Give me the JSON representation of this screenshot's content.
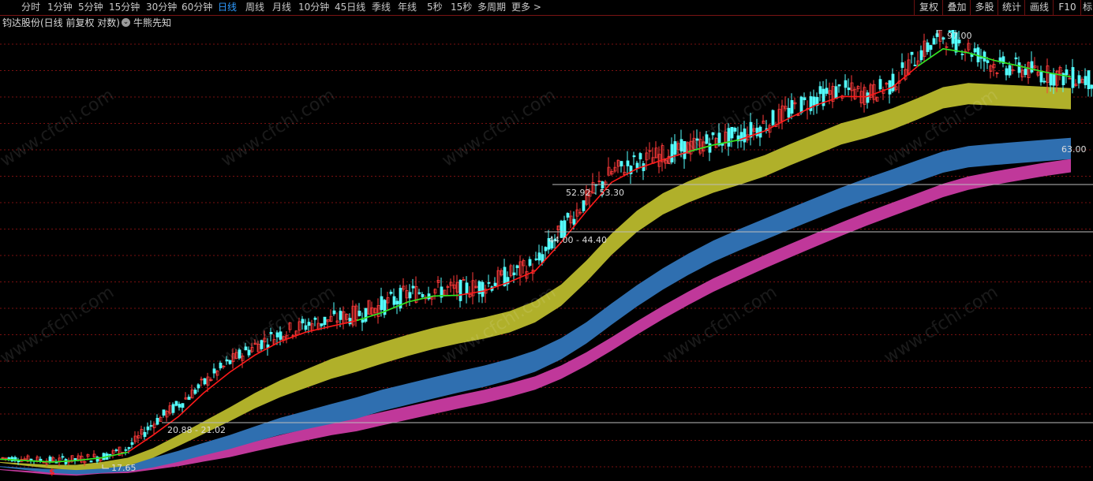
{
  "toolbar": {
    "periods": [
      "分时",
      "1分钟",
      "5分钟",
      "15分钟",
      "30分钟",
      "60分钟",
      "日线",
      "周线",
      "月线",
      "10分钟",
      "45日线",
      "季线",
      "年线",
      "5秒",
      "15秒",
      "多周期",
      "更多 >"
    ],
    "active_period": "日线",
    "right_buttons": [
      "复权",
      "叠加",
      "多股",
      "统计",
      "画线",
      "F10",
      "标"
    ]
  },
  "infobar": {
    "title": "钧达股份(日线 前复权 对数)",
    "indicator": "牛熊先知",
    "indicator_icon": "chevron-down-icon"
  },
  "watermark": "www.cfchi.com",
  "colors": {
    "background": "#000000",
    "grid": "#7a1010",
    "up_candle": "#ff3a3a",
    "down_candle": "#54ffff",
    "ma_red": "#ff1a1a",
    "ma_green": "#22ee22",
    "band_yellow": "#b0b02a",
    "band_blue": "#2f6fb0",
    "band_magenta": "#c0389a",
    "signal": "#ff2020"
  },
  "chart_data": {
    "type": "line",
    "scale": "log",
    "price_labels": {
      "high": "97.00",
      "low": "17.65",
      "levels": [
        "20.88 - 21.02",
        "44.00 - 44.40",
        "52.92 - 53.30",
        "63.00"
      ]
    },
    "series": [
      {
        "values": [
          17.9,
          17.8,
          17.7,
          17.8,
          18.0,
          18.6,
          20.6,
          22.2,
          24.2,
          26.3,
          28.1,
          29.5,
          30.5,
          31.1,
          31.8,
          33.0,
          34.5,
          35.1,
          35.0,
          35.7,
          37.3,
          38.8,
          44.5,
          50.5,
          56.3,
          58.5,
          60.2,
          62.0,
          63.7,
          65.0,
          68.0,
          72.0,
          75.8,
          78.0,
          76.5,
          80.0,
          90.0,
          97.0,
          92.0,
          86.0,
          85.0,
          83.0,
          82.0
        ]
      },
      {
        "values": [
          17.8,
          17.7,
          17.6,
          17.7,
          17.9,
          18.3,
          19.6,
          21.1,
          23.2,
          25.2,
          27.0,
          28.5,
          29.6,
          30.3,
          31.0,
          32.0,
          33.4,
          34.2,
          34.3,
          34.9,
          36.2,
          37.8,
          42.4,
          48.0,
          53.9,
          56.9,
          59.0,
          60.9,
          62.6,
          63.9,
          66.2,
          69.8,
          73.4,
          76.0,
          75.9,
          78.9,
          85.8,
          92.0,
          90.5,
          87.8,
          85.8,
          83.8,
          82.2
        ]
      },
      {
        "values": [
          17.6,
          17.5,
          17.4,
          17.4,
          17.6,
          17.9,
          18.6,
          19.6,
          20.7,
          21.9,
          23.2,
          24.4,
          25.5,
          26.6,
          27.5,
          28.4,
          29.3,
          30.1,
          30.8,
          31.4,
          32.2,
          33.5,
          35.8,
          39.4,
          43.9,
          48.1,
          51.6,
          54.1,
          56.3,
          58.1,
          60.1,
          62.8,
          65.5,
          68.3,
          70.1,
          72.5,
          75.5,
          78.9,
          80.2,
          79.8,
          79.4,
          79.0,
          78.6
        ]
      },
      {
        "values": [
          17.3,
          17.2,
          17.1,
          17.1,
          17.3,
          17.5,
          17.9,
          18.4,
          19.0,
          19.6,
          20.3,
          21.0,
          21.6,
          22.2,
          22.8,
          23.5,
          24.1,
          24.7,
          25.3,
          25.9,
          26.6,
          27.5,
          28.9,
          30.8,
          33.2,
          35.7,
          38.2,
          40.5,
          42.7,
          44.7,
          46.6,
          48.6,
          50.7,
          52.8,
          54.8,
          56.8,
          58.9,
          61.0,
          62.3,
          62.9,
          63.4,
          63.9,
          64.4
        ]
      },
      {
        "values": [
          17.1,
          17.0,
          16.9,
          16.9,
          17.1,
          17.2,
          17.5,
          17.8,
          18.2,
          18.6,
          19.1,
          19.6,
          20.1,
          20.6,
          21.0,
          21.5,
          22.0,
          22.5,
          23.0,
          23.5,
          24.1,
          24.8,
          25.9,
          27.3,
          29.0,
          30.9,
          32.9,
          34.8,
          36.7,
          38.5,
          40.3,
          42.1,
          44.0,
          45.9,
          47.8,
          49.7,
          51.6,
          53.6,
          55.2,
          56.3,
          57.3,
          58.3,
          59.2
        ]
      }
    ]
  }
}
